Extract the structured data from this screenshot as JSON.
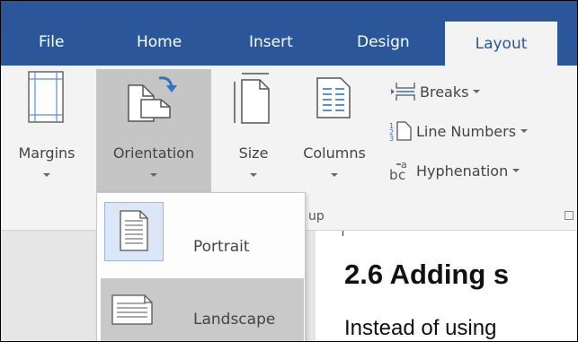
{
  "tabs": [
    {
      "label": "File"
    },
    {
      "label": "Home"
    },
    {
      "label": "Insert"
    },
    {
      "label": "Design"
    },
    {
      "label": "Layout",
      "active": true
    }
  ],
  "colors": {
    "tab_bar": "#2b579a",
    "ribbon": "#f3f3f3",
    "selected_button": "#c5c5c5",
    "hover_item": "#c9c9c9"
  },
  "ribbon": {
    "margins_label": "Margins",
    "orientation_label": "Orientation",
    "size_label": "Size",
    "columns_label": "Columns",
    "breaks_label": "Breaks",
    "line_numbers_label": "Line Numbers",
    "hyphenation_label": "Hyphenation",
    "group_label_visible": "up"
  },
  "orientation_menu": {
    "items": [
      {
        "label": "Portrait",
        "icon": "portrait-page-icon",
        "selected": true
      },
      {
        "label": "Landscape",
        "icon": "landscape-page-icon",
        "hovered": true
      }
    ]
  },
  "document": {
    "heading": "2.6  Adding s",
    "body_text": "Instead of using"
  }
}
